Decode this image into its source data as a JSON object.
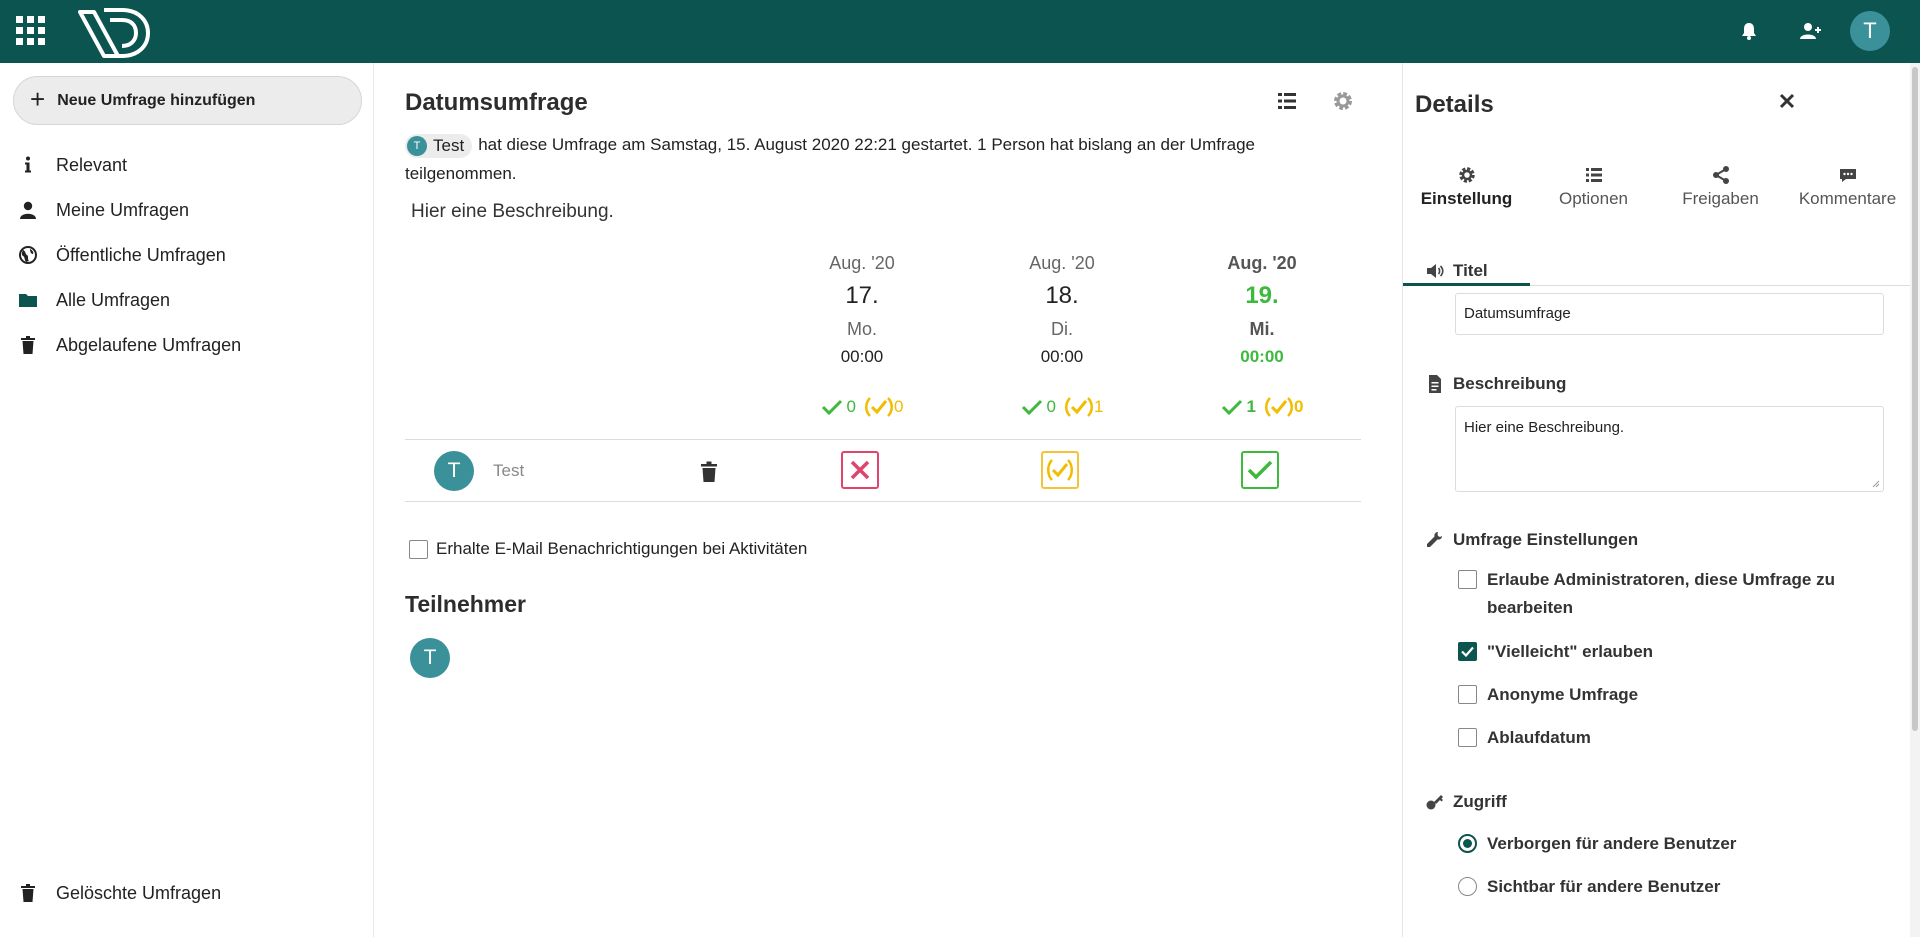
{
  "header": {
    "avatar_letter": "T"
  },
  "nav": {
    "new_poll": "Neue Umfrage hinzufügen",
    "items": [
      {
        "label": "Relevant",
        "icon": "info-icon"
      },
      {
        "label": "Meine Umfragen",
        "icon": "user-icon"
      },
      {
        "label": "Öffentliche Umfragen",
        "icon": "globe-icon"
      },
      {
        "label": "Alle Umfragen",
        "icon": "folder-icon"
      },
      {
        "label": "Abgelaufene Umfragen",
        "icon": "trash-icon"
      }
    ],
    "deleted": "Gelöschte Umfragen"
  },
  "poll": {
    "title": "Datumsumfrage",
    "owner": "Test",
    "owner_initial": "T",
    "info": "hat diese Umfrage am Samstag, 15. August 2020 22:21 gestartet. 1 Person hat bislang an der Umfrage teilgenommen.",
    "description": "Hier eine Beschreibung.",
    "options": [
      {
        "month": "Aug. '20",
        "day": "17.",
        "weekday": "Mo.",
        "time": "00:00",
        "yes": "0",
        "maybe": "0",
        "highlight": false
      },
      {
        "month": "Aug. '20",
        "day": "18.",
        "weekday": "Di.",
        "time": "00:00",
        "yes": "0",
        "maybe": "1",
        "highlight": false
      },
      {
        "month": "Aug. '20",
        "day": "19.",
        "weekday": "Mi.",
        "time": "00:00",
        "yes": "1",
        "maybe": "0",
        "highlight": true
      }
    ],
    "row": {
      "initial": "T",
      "name": "Test",
      "votes": [
        "no",
        "maybe",
        "yes"
      ]
    },
    "email_label": "Erhalte E-Mail Benachrichtigungen bei Aktivitäten",
    "participants_heading": "Teilnehmer",
    "participant_initial": "T"
  },
  "sidebar": {
    "title": "Details",
    "tabs": [
      "Einstellung",
      "Optionen",
      "Freigaben",
      "Kommentare"
    ],
    "active_tab": "Einstellung",
    "title_label": "Titel",
    "title_value": "Datumsumfrage",
    "desc_label": "Beschreibung",
    "desc_value": "Hier eine Beschreibung.",
    "settings_label": "Umfrage Einstellungen",
    "settings": [
      {
        "label": "Erlaube Administratoren, diese Umfrage zu bearbeiten",
        "checked": false
      },
      {
        "label": "\"Vielleicht\" erlauben",
        "checked": true
      },
      {
        "label": "Anonyme Umfrage",
        "checked": false
      },
      {
        "label": "Ablaufdatum",
        "checked": false
      }
    ],
    "access_label": "Zugriff",
    "access_options": [
      {
        "label": "Verborgen für andere Benutzer",
        "checked": true
      },
      {
        "label": "Sichtbar für andere Benutzer",
        "checked": false
      }
    ]
  },
  "colors": {
    "header": "#0b5450",
    "yes": "#3db93d",
    "maybe": "#f0bd00",
    "no": "#e0436c",
    "avatar": "#3b9199"
  }
}
